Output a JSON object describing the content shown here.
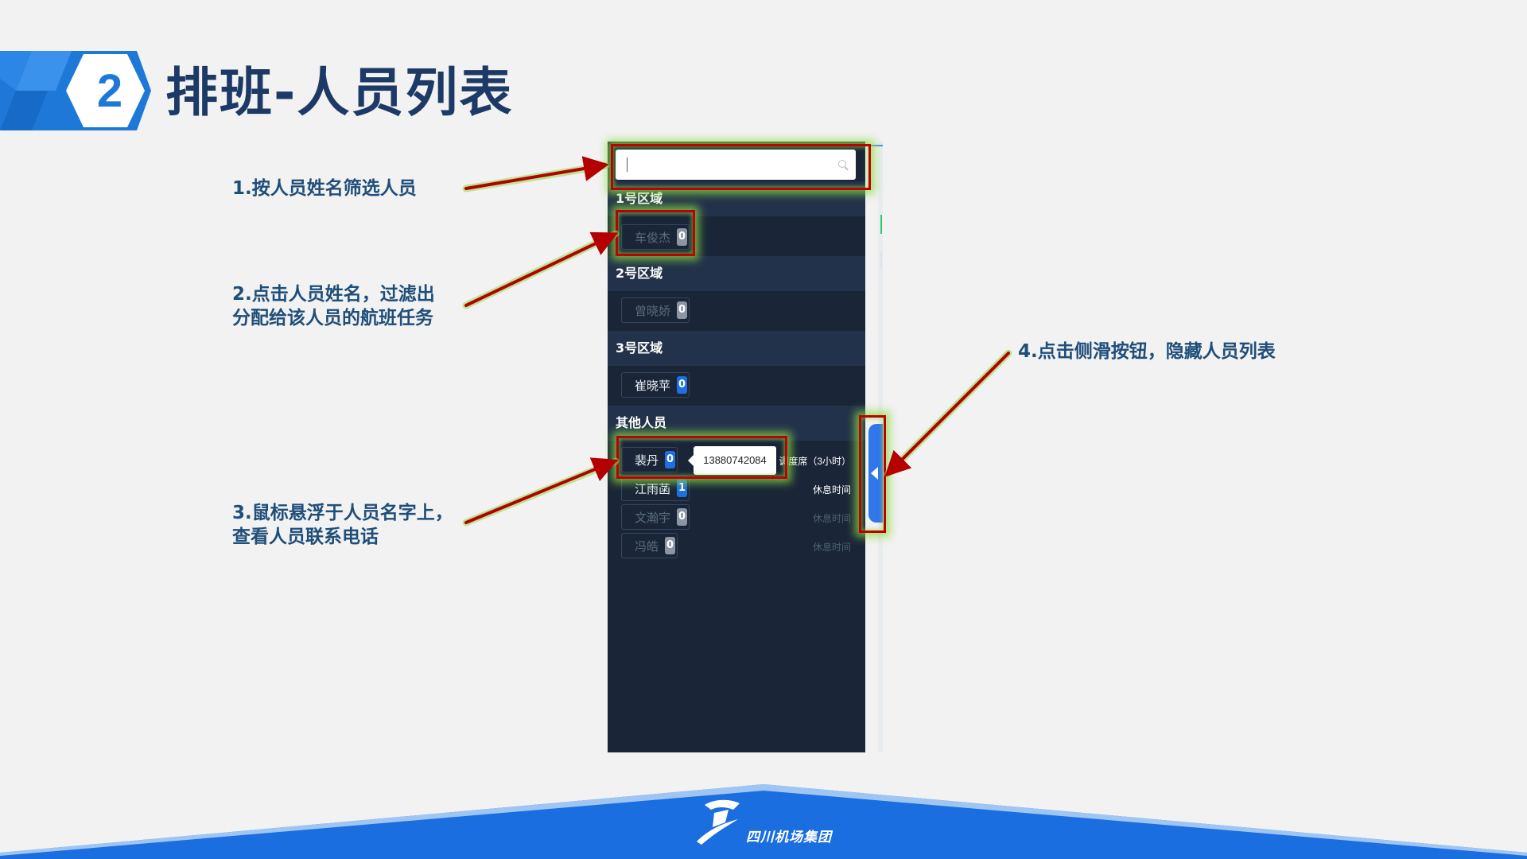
{
  "slide": {
    "number": "2",
    "title": "排班-人员列表"
  },
  "annotations": {
    "note1": "1.按人员姓名筛选人员",
    "note2_line1": "2.点击人员姓名，过滤出",
    "note2_line2": "分配给该人员的航班任务",
    "note3_line1": "3.鼠标悬浮于人员名字上，",
    "note3_line2": "查看人员联系电话",
    "note4": "4.点击侧滑按钮，隐藏人员列表"
  },
  "search": {
    "value": "",
    "placeholder": ""
  },
  "groups": [
    {
      "name": "1号区域",
      "people": [
        {
          "name": "车俊杰",
          "count": "0"
        }
      ]
    },
    {
      "name": "2号区域",
      "people": [
        {
          "name": "曾晓娇",
          "count": "0"
        }
      ]
    },
    {
      "name": "3号区域",
      "people": [
        {
          "name": "崔晓苹",
          "count": "0"
        }
      ]
    },
    {
      "name": "其他人员",
      "people": [
        {
          "name": "裴丹",
          "count": "0",
          "status": "调度席（3小时）"
        },
        {
          "name": "江雨菡",
          "count": "1",
          "status": "休息时间"
        },
        {
          "name": "文瀚宇",
          "count": "0",
          "status": "休息时间"
        },
        {
          "name": "冯皓",
          "count": "0",
          "status": "休息时间"
        }
      ]
    }
  ],
  "tooltip": {
    "phone": "13880742084"
  },
  "footer": {
    "company": "四川机场集团"
  },
  "colors": {
    "panel_bg": "#1a2638",
    "group_header_bg": "#22324a",
    "badge_blue": "#1f6fe0",
    "highlight_border": "#c00000",
    "highlight_glow": "#8cdc46",
    "title": "#1d3a66",
    "brand_blue": "#1e78d8"
  },
  "icons": [
    "search-icon",
    "collapse-arrow-icon",
    "company-logo-icon"
  ]
}
